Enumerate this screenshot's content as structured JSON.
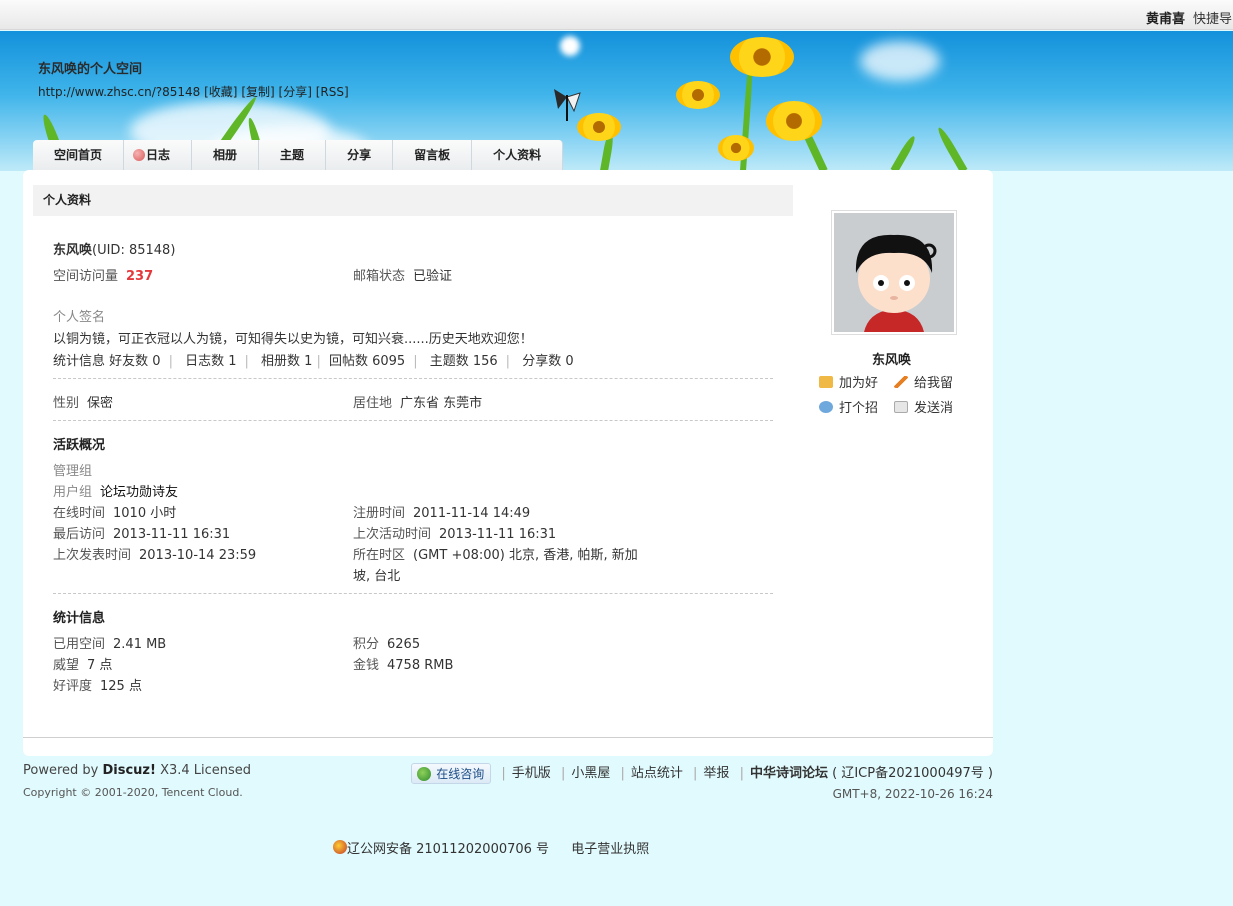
{
  "topbar": {
    "username": "黄甫喜",
    "quick_nav": "快捷导"
  },
  "header": {
    "space_title": "东风唤的个人空间",
    "space_url": "http://www.zhsc.cn/?85148",
    "url_links": [
      "[收藏]",
      "[复制]",
      "[分享]",
      "[RSS]"
    ]
  },
  "nav": {
    "tabs": [
      "空间首页",
      "日志",
      "相册",
      "主题",
      "分享",
      "留言板",
      "个人资料"
    ]
  },
  "profile": {
    "section_title": "个人资料",
    "name": "东风唤",
    "uid": "(UID: 85148)",
    "visits_label": "空间访问量",
    "visits": "237",
    "email_label": "邮箱状态",
    "email_value": "已验证",
    "signature_label": "个人签名",
    "signature": "以铜为镜，可正衣冠以人为镜，可知得失以史为镜，可知兴衰......历史天地欢迎您！",
    "stats_label": "统计信息",
    "stats": [
      "好友数 0",
      "日志数 1",
      "相册数 1",
      "回帖数 6095",
      "主题数 156",
      "分享数 0"
    ],
    "gender_label": "性别",
    "gender": "保密",
    "residence_label": "居住地",
    "residence": "广东省 东莞市"
  },
  "activity": {
    "title": "活跃概况",
    "admin_group_label": "管理组",
    "user_group_label": "用户组",
    "user_group": "论坛功勋诗友",
    "online_label": "在线时间",
    "online": "1010 小时",
    "register_label": "注册时间",
    "register": "2011-11-14 14:49",
    "last_visit_label": "最后访问",
    "last_visit": "2013-11-11 16:31",
    "last_active_label": "上次活动时间",
    "last_active": "2013-11-11 16:31",
    "last_post_label": "上次发表时间",
    "last_post": "2013-10-14 23:59",
    "timezone_label": "所在时区",
    "timezone_line1": "(GMT +08:00) 北京, 香港, 帕斯, 新加",
    "timezone_line2": "坡, 台北"
  },
  "statistics": {
    "title": "统计信息",
    "space_used_label": "已用空间",
    "space_used": "2.41 MB",
    "points_label": "积分",
    "points": "6265",
    "prestige_label": "威望",
    "prestige": "7 点",
    "money_label": "金钱",
    "money": "4758 RMB",
    "rating_label": "好评度",
    "rating": "125 点"
  },
  "side": {
    "name": "东风唤",
    "add_friend": "加为好",
    "leave_msg": "给我留",
    "greet": "打个招",
    "send_msg": "发送消"
  },
  "footer": {
    "powered_prefix": "Powered by ",
    "powered_brand": "Discuz!",
    "powered_suffix": " X3.4 Licensed",
    "copyright": "Copyright © 2001-2020, Tencent Cloud.",
    "consult": "在线咨询",
    "links": [
      "手机版",
      "小黑屋",
      "站点统计",
      "举报"
    ],
    "site_name": "中华诗词论坛",
    "icp": "( 辽ICP备2021000497号 )",
    "time": "GMT+8, 2022-10-26 16:24",
    "police": "辽公网安备 21011202000706 号",
    "license": "电子营业执照"
  }
}
